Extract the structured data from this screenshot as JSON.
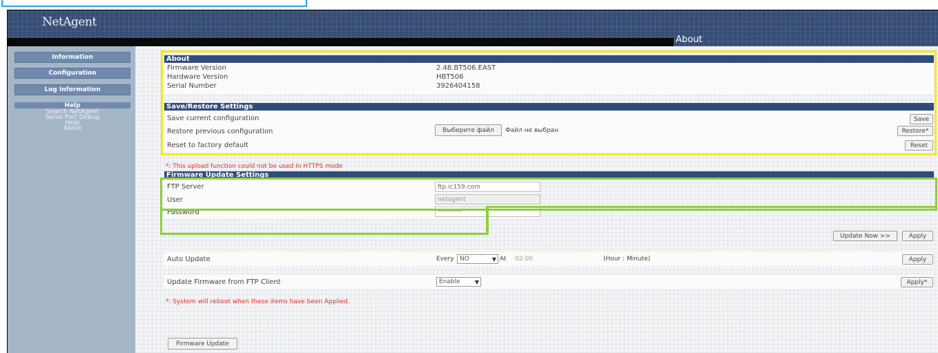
{
  "header": {
    "logo": "NetAgent",
    "page_title": "About"
  },
  "sidebar": {
    "buttons": [
      "Information",
      "Configuration",
      "Log Information",
      "Help"
    ],
    "help_links": [
      "Search NetAgent",
      "Serial Port Debug",
      "Help",
      "About"
    ]
  },
  "about": {
    "title": "About",
    "rows": [
      {
        "label": "Firmware Version",
        "value": "2.48.BT506.EAST"
      },
      {
        "label": "Hardware Version",
        "value": "HBT506"
      },
      {
        "label": "Serial Number",
        "value": "3926404158"
      }
    ]
  },
  "save_restore": {
    "title": "Save/Restore Settings",
    "save_label": "Save current configuration",
    "save_button": "Save",
    "restore_label": "Restore previous configuration",
    "choose_file_button": "Выберите файл",
    "no_file_text": "Файл не выбран",
    "restore_button": "Restore*",
    "reset_label": "Reset to factory default",
    "reset_button": "Reset"
  },
  "notes": {
    "https_warning": "*: This upload function could not be used in HTTPS mode",
    "reboot_warning": "*: System will reboot when these items have been Applied."
  },
  "firmware_update": {
    "title": "Firmware Update Settings",
    "ftp_server_label": "FTP Server",
    "ftp_server_value": "ftp.ic159.com",
    "user_label": "User",
    "user_value": "netagent",
    "password_label": "Password",
    "password_value": "********",
    "update_now_button": "Update Now >>",
    "apply_button": "Apply",
    "auto_update_label": "Auto Update",
    "every_label": "Every",
    "every_value": "NO",
    "at_label": "At",
    "at_value": "02:00",
    "hour_minute_label": "(Hour : Minute)",
    "auto_apply_button": "Apply",
    "ftp_client_label": "Update Firmware from FTP Client",
    "ftp_client_value": "Enable",
    "ftp_client_apply_button": "Apply*",
    "firmware_update_button": "Firmware Update"
  },
  "colors": {
    "header_bg": "#364d75",
    "section_header": "#2f4c7b",
    "sidebar_bg": "#a5b6c9",
    "warning_red": "#d9302b",
    "highlight_yellow": "#f4ea1c",
    "highlight_green": "#8dcf3a",
    "highlight_blue": "#2aa3e6"
  }
}
